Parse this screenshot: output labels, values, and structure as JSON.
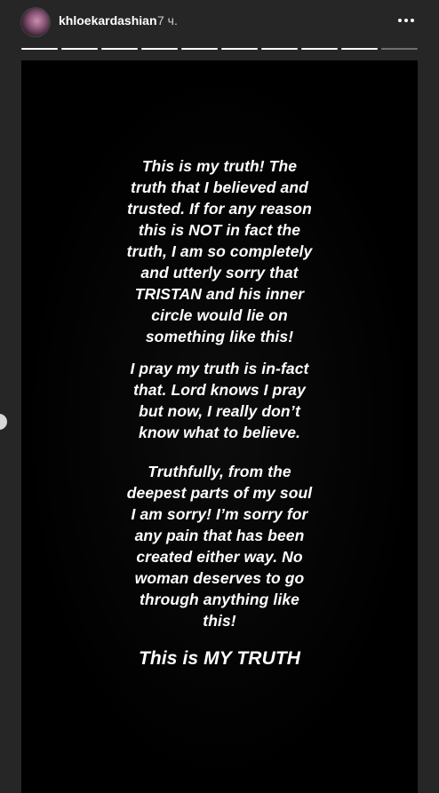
{
  "header": {
    "username": "khloekardashian",
    "time": "7 ч."
  },
  "progress": {
    "segments": 10,
    "current_segment": 10,
    "current_fraction": 0.2
  },
  "story": {
    "paragraph1": "This is my truth! The\ntruth that I believed and\ntrusted. If for any reason\nthis is NOT in fact the\ntruth, I am so completely\nand utterly sorry that\nTRISTAN and his inner\ncircle would lie on\nsomething like this!",
    "paragraph2": "I pray my truth is in-fact\nthat. Lord knows I pray\nbut now, I really don’t\nknow what to believe.",
    "paragraph3": "Truthfully, from the\ndeepest parts of my soul\nI am sorry! I’m sorry for\nany pain that has been\ncreated either way. No\nwoman deserves to go\nthrough anything like\nthis!",
    "closing": "This is MY TRUTH"
  },
  "colors": {
    "background": "#262626",
    "story_background": "#000000",
    "text": "#ffffff"
  }
}
